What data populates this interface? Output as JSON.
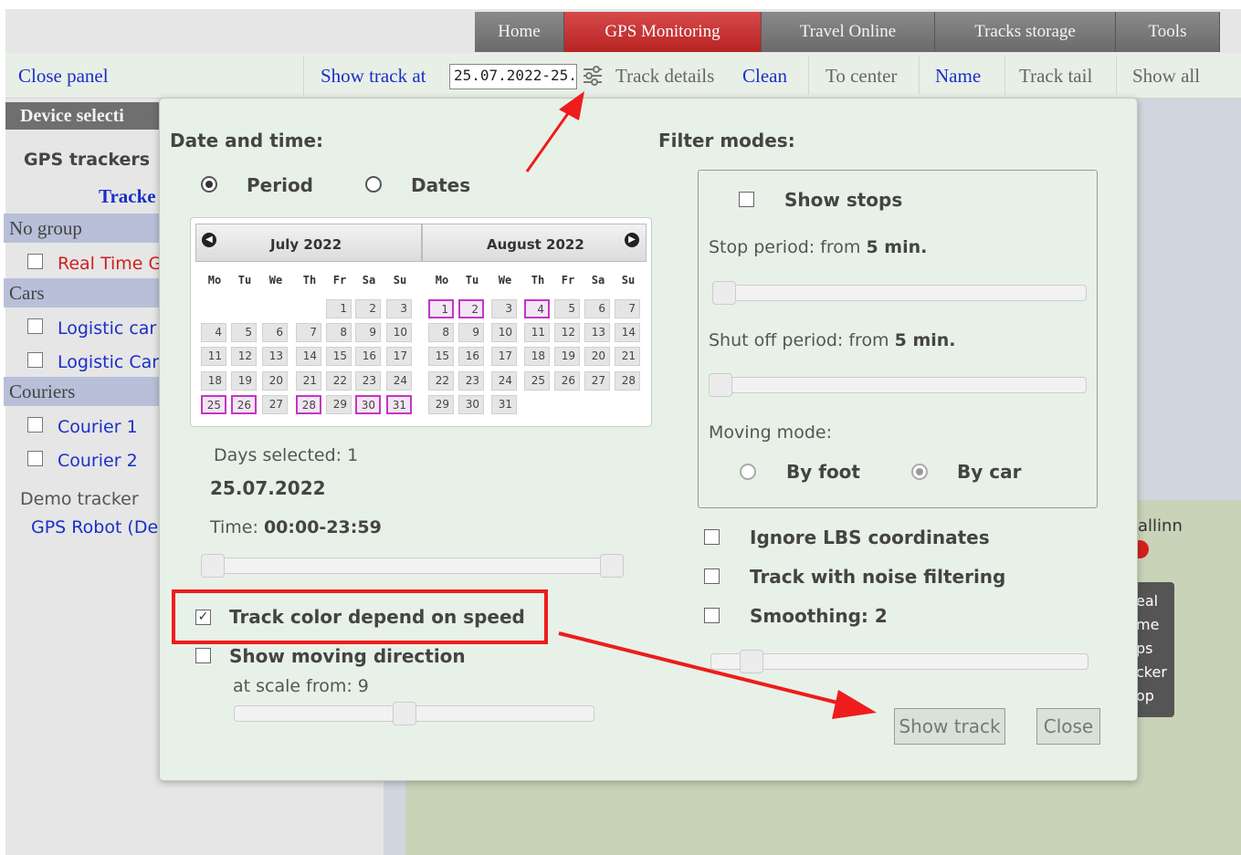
{
  "nav": {
    "tabs": [
      "Home",
      "GPS Monitoring",
      "Travel Online",
      "Tracks storage",
      "Tools"
    ],
    "active": "GPS Monitoring"
  },
  "toolbar": {
    "close_panel": "Close panel",
    "show_track_at": "Show track at",
    "date_value": "25.07.2022-25.0",
    "track_details": "Track details",
    "clean": "Clean",
    "to_center": "To center",
    "name": "Name",
    "track_tail": "Track tail",
    "show_all": "Show all"
  },
  "left_panel": {
    "header": "Device selecti",
    "gps_trackers": "GPS trackers",
    "trackers_link": "Tracke",
    "groups": [
      {
        "label": "No group",
        "items": [
          "Real Time G"
        ]
      },
      {
        "label": "Cars",
        "items": [
          "Logistic car",
          "Logistic Car"
        ]
      },
      {
        "label": "Couriers",
        "items": [
          "Courier 1",
          "Courier 2"
        ]
      }
    ],
    "demo_tracker": "Demo tracker",
    "gps_robot": "GPS Robot (De"
  },
  "map": {
    "city": "allinn",
    "tooltip_lines": [
      "eal",
      "me",
      "ps",
      "cker",
      "op"
    ]
  },
  "dialog": {
    "date_time_label": "Date and time:",
    "period_label": "Period",
    "dates_label": "Dates",
    "calendar": {
      "months": [
        "July 2022",
        "August 2022"
      ],
      "weekdays": [
        "Mo",
        "Tu",
        "We",
        "Th",
        "Fr",
        "Sa",
        "Su"
      ],
      "july_days": [
        1,
        2,
        3,
        4,
        5,
        6,
        7,
        8,
        9,
        10,
        11,
        12,
        13,
        14,
        15,
        16,
        17,
        18,
        19,
        20,
        21,
        22,
        23,
        24,
        25,
        26,
        27,
        28,
        29,
        30,
        31
      ],
      "july_selected": [
        25,
        26,
        28,
        30,
        31
      ],
      "august_days": [
        1,
        2,
        3,
        4,
        5,
        6,
        7,
        8,
        9,
        10,
        11,
        12,
        13,
        14,
        15,
        16,
        17,
        18,
        19,
        20,
        21,
        22,
        23,
        24,
        25,
        26,
        27,
        28,
        29,
        30,
        31
      ],
      "august_selected": [
        1,
        2,
        4
      ]
    },
    "days_selected": "Days selected: 1",
    "date_display": "25.07.2022",
    "time_label": "Time:",
    "time_value": "00:00-23:59",
    "track_color_label": "Track color depend on speed",
    "show_moving_direction": "Show moving direction",
    "at_scale_label": "at scale from: 9",
    "filter_modes_label": "Filter modes:",
    "show_stops": "Show stops",
    "stop_period_label": "Stop period: from",
    "stop_period_value": "5 min.",
    "shut_off_label": "Shut off period: from",
    "shut_off_value": "5 min.",
    "moving_mode_label": "Moving mode:",
    "by_foot": "By foot",
    "by_car": "By car",
    "ignore_lbs": "Ignore LBS coordinates",
    "noise_filtering": "Track with noise filtering",
    "smoothing": "Smoothing: 2",
    "show_track_button": "Show track",
    "close_button": "Close"
  },
  "colors": {
    "accent_red": "#ee1c1c",
    "active_tab": "#c62c2c",
    "link_blue": "#1a2fc8",
    "selected_day_border": "#c436c4"
  }
}
